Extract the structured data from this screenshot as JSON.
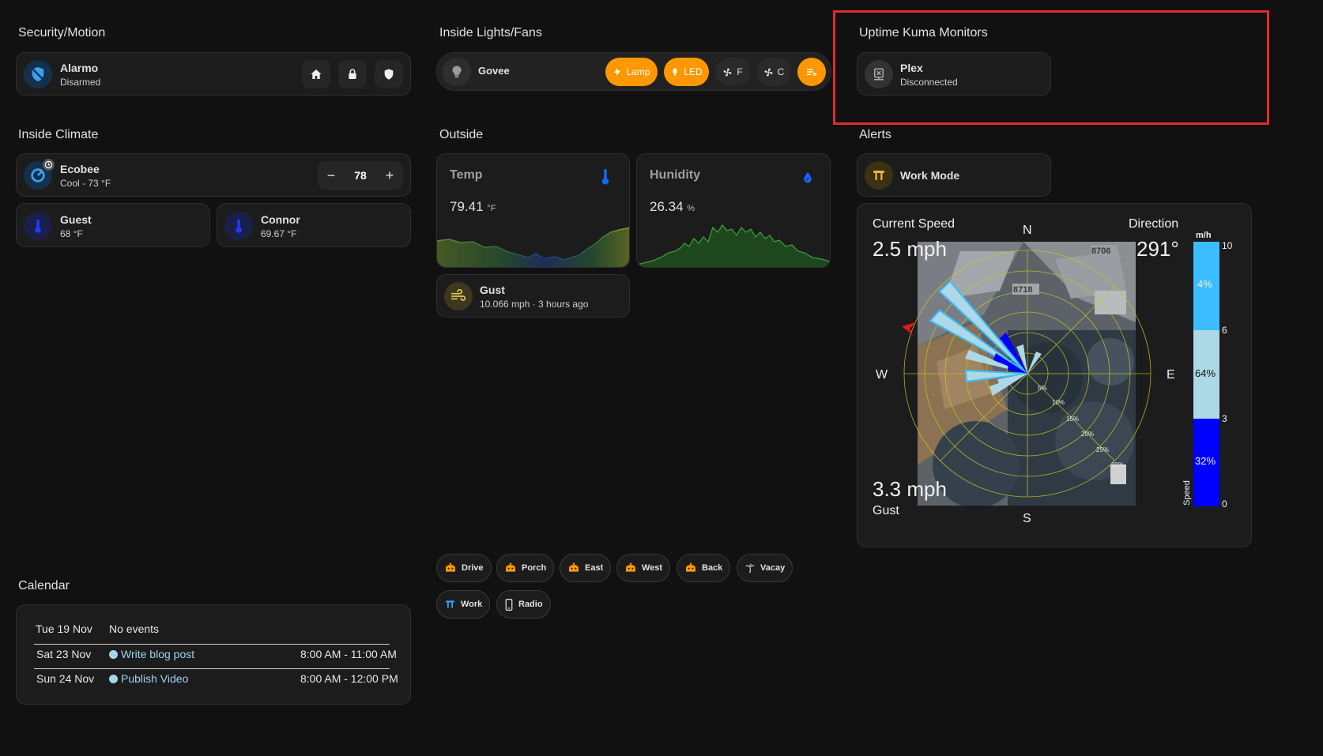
{
  "sections": {
    "security": "Security/Motion",
    "lights": "Inside Lights/Fans",
    "uptime": "Uptime Kuma Monitors",
    "climate": "Inside Climate",
    "outside": "Outside",
    "alerts": "Alerts",
    "calendar": "Calendar"
  },
  "alarmo": {
    "name": "Alarmo",
    "state": "Disarmed",
    "icons": [
      "shield-off-icon",
      "home-icon",
      "lock-icon",
      "shield-icon"
    ]
  },
  "govee": {
    "name": "Govee",
    "buttons": [
      {
        "label": "Lamp",
        "icon": "lightning-icon",
        "active": true
      },
      {
        "label": "LED",
        "icon": "light-icon",
        "active": true
      },
      {
        "label": "F",
        "icon": "fan-icon",
        "active": false
      },
      {
        "label": "C",
        "icon": "fan-icon",
        "active": false
      }
    ]
  },
  "uptime": {
    "name": "Plex",
    "state": "Disconnected"
  },
  "ecobee": {
    "name": "Ecobee",
    "state": "Cool - 73 °F",
    "minus": "−",
    "setpoint": "78",
    "plus": "+"
  },
  "sensors": [
    {
      "name": "Guest",
      "value": "68 °F"
    },
    {
      "name": "Connor",
      "value": "69.67 °F"
    }
  ],
  "outside": {
    "temp": {
      "label": "Temp",
      "value": "79.41",
      "unit": "°F"
    },
    "humidity": {
      "label": "Hunidity",
      "value": "26.34",
      "unit": "%"
    },
    "gust": {
      "name": "Gust",
      "value": "10.066 mph · 3 hours ago"
    }
  },
  "alerts": {
    "name": "Work Mode"
  },
  "wind": {
    "current_label": "Current Speed",
    "current_value": "2.5 mph",
    "direction_label": "Direction",
    "direction_value": "291°",
    "gust_value": "3.3 mph",
    "gust_label": "Gust",
    "compass": {
      "n": "N",
      "s": "S",
      "e": "E",
      "w": "W"
    },
    "rings": [
      "5%",
      "10%",
      "15%",
      "20%",
      "25%",
      "30%"
    ],
    "scale_unit": "m/h",
    "scale_ticks": [
      "10",
      "6",
      "3",
      "0"
    ],
    "scale_pcts": [
      "4%",
      "64%",
      "32%"
    ],
    "scale_axis": "Speed",
    "map_labels": [
      "8706",
      "8718"
    ],
    "colors": {
      "low": "#0000ff",
      "mid": "#add8e6",
      "high": "#3cbdff"
    }
  },
  "chips": [
    {
      "label": "Drive",
      "icon": "robot-icon"
    },
    {
      "label": "Porch",
      "icon": "robot-icon"
    },
    {
      "label": "East",
      "icon": "robot-icon"
    },
    {
      "label": "West",
      "icon": "robot-icon"
    },
    {
      "label": "Back",
      "icon": "robot-icon"
    },
    {
      "label": "Vacay",
      "icon": "palm-icon"
    },
    {
      "label": "Work",
      "icon": "work-icon"
    },
    {
      "label": "Radio",
      "icon": "phone-icon"
    }
  ],
  "calendar": {
    "rows": [
      {
        "date": "Tue 19 Nov",
        "event": "No events",
        "time": ""
      },
      {
        "date": "Sat 23 Nov",
        "event": "Write blog post",
        "time": "8:00 AM - 11:00 AM"
      },
      {
        "date": "Sun 24 Nov",
        "event": "Publish Video",
        "time": "8:00 AM - 12:00 PM"
      }
    ]
  },
  "highlight_color": "#e02b2b",
  "accent": "#ff9800"
}
